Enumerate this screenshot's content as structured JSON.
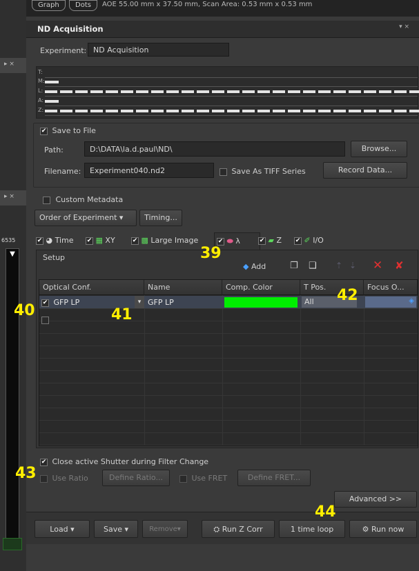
{
  "top_strip": {
    "left_pill_1": "Graph",
    "left_pill_2": "Dots",
    "text": "AOE 55.00 mm x 37.50 mm, Scan Area: 0.53 mm x 0.53 mm"
  },
  "left_strip": {
    "value_label": "6535"
  },
  "panel": {
    "title": "ND Acquisition"
  },
  "experiment": {
    "label": "Experiment:",
    "value": "ND Acquisition"
  },
  "timeline": {
    "rows": [
      "T:",
      "M:",
      "L:",
      "A:",
      "Z:"
    ]
  },
  "save": {
    "label": "Save to File",
    "path_label": "Path:",
    "path_value": "D:\\DATA\\la.d.paul\\ND\\",
    "browse": "Browse...",
    "filename_label": "Filename:",
    "filename_value": "Experiment040.nd2",
    "tiff_label": "Save As TIFF Series",
    "record": "Record Data..."
  },
  "metadata": {
    "label": "Custom Metadata"
  },
  "order": {
    "label": "Order of Experiment",
    "timing": "Timing..."
  },
  "tabs": [
    "Time",
    "XY",
    "Large Image",
    "λ",
    "Z",
    "I/O"
  ],
  "setup": {
    "label": "Setup",
    "add": "Add"
  },
  "grid": {
    "columns": [
      "Optical Conf.",
      "Name",
      "Comp. Color",
      "T Pos.",
      "Focus O..."
    ],
    "row1": {
      "optical": "GFP LP",
      "name": "GFP LP",
      "color": "#00ee00",
      "tpos": "All"
    }
  },
  "options": {
    "close_shutter": "Close active Shutter during Filter Change",
    "use_ratio": "Use Ratio",
    "define_ratio": "Define Ratio...",
    "use_fret": "Use FRET",
    "define_fret": "Define FRET..."
  },
  "advanced": "Advanced >>",
  "bottom": {
    "load": "Load",
    "save": "Save",
    "remove": "Remove",
    "run_z": "Run Z Corr",
    "time_loop": "1 time loop",
    "run_now": "Run now"
  },
  "callouts": {
    "c39": "39",
    "c40": "40",
    "c41": "41",
    "c42": "42",
    "c43": "43",
    "c44": "44"
  },
  "colors": {
    "accent_green": "#00ee00",
    "callout_yellow": "#ffee00",
    "delete_red": "#e03030"
  }
}
